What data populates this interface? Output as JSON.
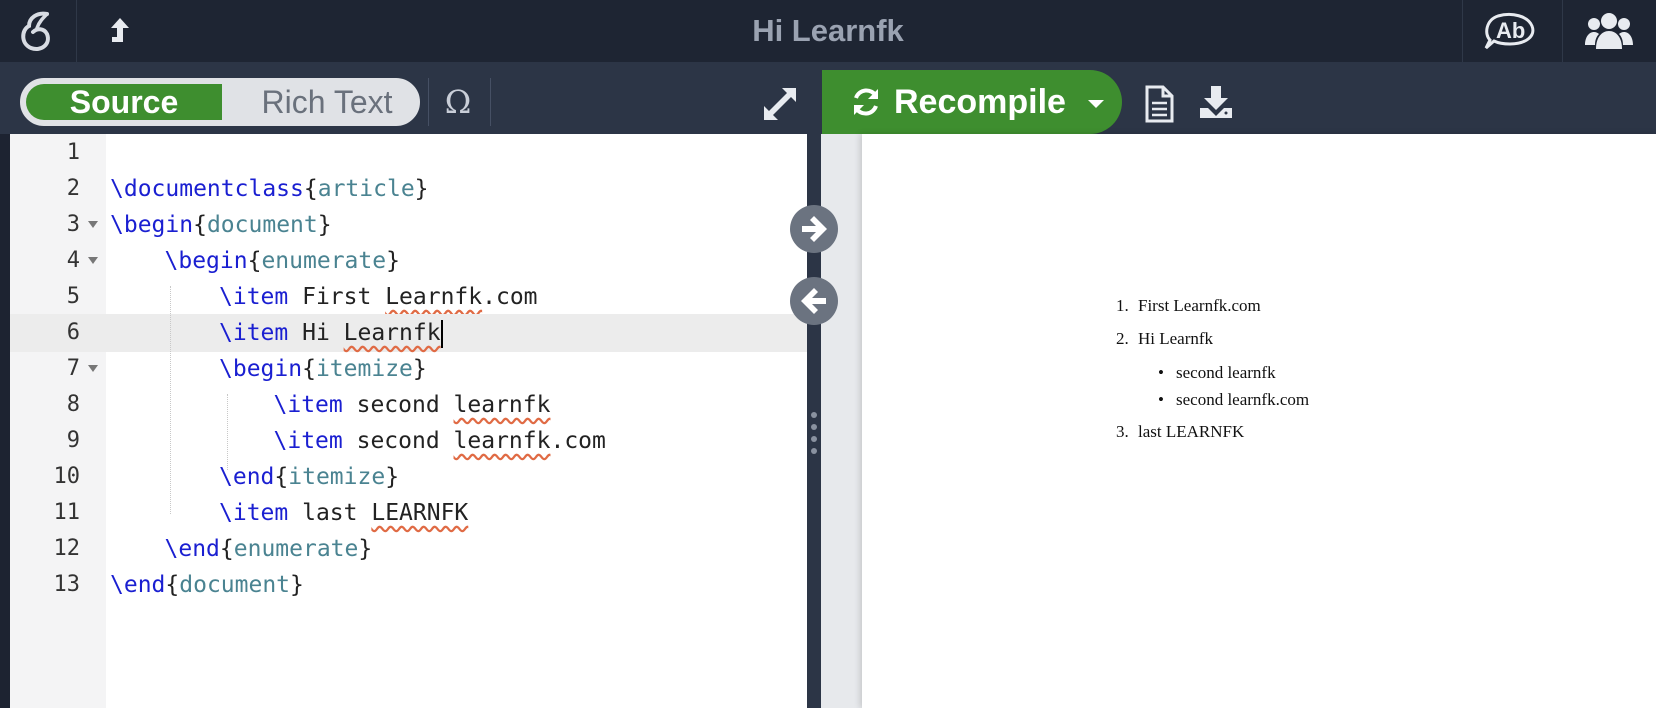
{
  "topbar": {
    "title": "Hi Learnfk",
    "menu_icon": "overleaf-logo-icon",
    "upload_icon": "share-arrow-icon",
    "review_icon": "track-changes-icon",
    "share_icon": "users-icon"
  },
  "toolbar": {
    "source_label": "Source",
    "rich_text_label": "Rich Text",
    "symbol_label": "Ω",
    "recompile_label": "Recompile"
  },
  "editor": {
    "lines": [
      {
        "num": "1",
        "text": ""
      },
      {
        "num": "2",
        "kw": "\\documentclass",
        "arg": "article"
      },
      {
        "num": "3",
        "kw": "\\begin",
        "arg": "document"
      },
      {
        "num": "4",
        "kw": "\\begin",
        "arg": "enumerate"
      },
      {
        "num": "5",
        "kw": "\\item",
        "rest": " First ",
        "spell": "Learnfk",
        "tail": ".com"
      },
      {
        "num": "6",
        "kw": "\\item",
        "rest": " Hi ",
        "spell": "Learnfk"
      },
      {
        "num": "7",
        "kw": "\\begin",
        "arg": "itemize"
      },
      {
        "num": "8",
        "kw": "\\item",
        "rest": " second ",
        "spell": "learnfk"
      },
      {
        "num": "9",
        "kw": "\\item",
        "rest": " second ",
        "spell": "learnfk",
        "tail": ".com"
      },
      {
        "num": "10",
        "kw": "\\end",
        "arg": "itemize"
      },
      {
        "num": "11",
        "kw": "\\item",
        "rest": " last ",
        "spell": "LEARNFK"
      },
      {
        "num": "12",
        "kw": "\\end",
        "arg": "enumerate"
      },
      {
        "num": "13",
        "kw": "\\end",
        "arg": "document"
      }
    ]
  },
  "preview": {
    "items": [
      {
        "marker": "1.",
        "text": "First Learnfk.com"
      },
      {
        "marker": "2.",
        "text": "Hi Learnfk"
      },
      {
        "marker": "•",
        "text": "second learnfk"
      },
      {
        "marker": "•",
        "text": "second learnfk.com"
      },
      {
        "marker": "3.",
        "text": "last LEARNFK"
      }
    ]
  },
  "colors": {
    "accent_green": "#3e8e2f",
    "topbar": "#1e2533",
    "toolbar": "#2c3546",
    "keyword": "#1a1fd1",
    "argument": "#4a8391"
  }
}
